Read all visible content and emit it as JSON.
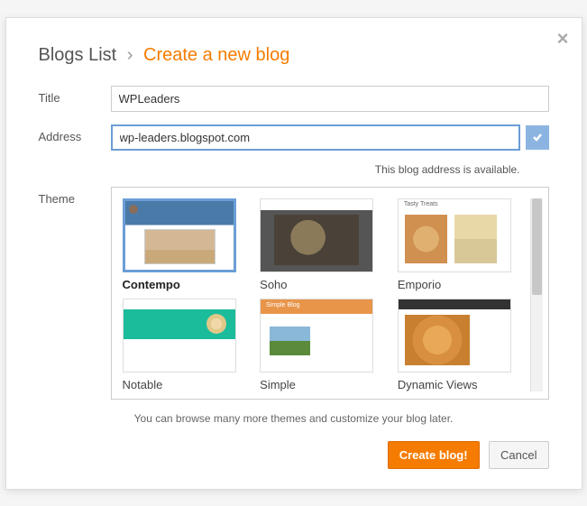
{
  "header": {
    "breadcrumb_root": "Blogs List",
    "separator": "›",
    "current": "Create a new blog"
  },
  "labels": {
    "title": "Title",
    "address": "Address",
    "theme": "Theme"
  },
  "fields": {
    "title_value": "WPLeaders",
    "address_value": "wp-leaders.blogspot.com"
  },
  "messages": {
    "address_available": "This blog address is available.",
    "theme_hint": "You can browse many more themes and customize your blog later."
  },
  "themes": [
    {
      "name": "Contempo",
      "selected": true
    },
    {
      "name": "Soho",
      "selected": false
    },
    {
      "name": "Emporio",
      "selected": false,
      "thumb_text": "Tasty Treats"
    },
    {
      "name": "Notable",
      "selected": false
    },
    {
      "name": "Simple",
      "selected": false,
      "thumb_text": "Simple Blog"
    },
    {
      "name": "Dynamic Views",
      "selected": false
    }
  ],
  "buttons": {
    "create": "Create blog!",
    "cancel": "Cancel"
  }
}
